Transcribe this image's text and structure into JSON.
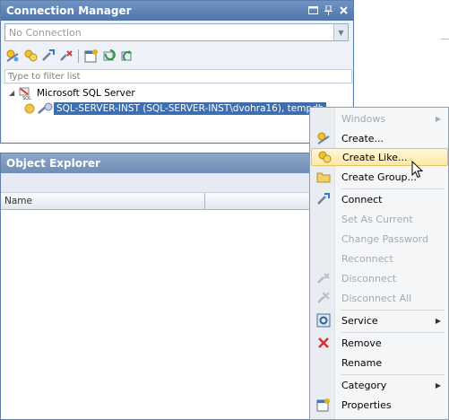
{
  "connection_manager": {
    "title": "Connection Manager",
    "title_buttons": [
      "window-position",
      "pin",
      "close"
    ],
    "connection_select": {
      "value": "No Connection"
    },
    "toolbar": [
      "create-connection-icon",
      "create-like-icon",
      "connect-icon",
      "disconnect-icon",
      "properties-icon",
      "refresh-icon",
      "refresh-green-icon"
    ],
    "filter_placeholder": "Type to filter list",
    "tree": {
      "root_label": "Microsoft SQL Server",
      "connection_label": "SQL-SERVER-INST (SQL-SERVER-INST\\dvohra16), tempdb"
    }
  },
  "object_explorer": {
    "title": "Object Explorer",
    "columns": [
      "Name",
      ""
    ]
  },
  "context_menu": {
    "items": [
      {
        "label": "Windows",
        "icon": "",
        "enabled": false,
        "submenu": true
      },
      {
        "label": "Create...",
        "icon": "create-connection-icon",
        "enabled": true,
        "submenu": false
      },
      {
        "label": "Create Like...",
        "icon": "create-like-icon",
        "enabled": true,
        "submenu": false,
        "highlighted": true
      },
      {
        "label": "Create Group...",
        "icon": "folder-icon",
        "enabled": true,
        "submenu": false
      },
      {
        "label": "Connect",
        "icon": "connect-icon",
        "enabled": true,
        "submenu": false
      },
      {
        "label": "Set As Current",
        "icon": "",
        "enabled": false,
        "submenu": false
      },
      {
        "label": "Change Password",
        "icon": "",
        "enabled": false,
        "submenu": false
      },
      {
        "label": "Reconnect",
        "icon": "",
        "enabled": false,
        "submenu": false
      },
      {
        "label": "Disconnect",
        "icon": "disconnect-icon",
        "enabled": false,
        "submenu": false
      },
      {
        "label": "Disconnect All",
        "icon": "disconnect-all-icon",
        "enabled": false,
        "submenu": false
      },
      {
        "label": "Service",
        "icon": "service-icon",
        "enabled": true,
        "submenu": true
      },
      {
        "label": "Remove",
        "icon": "remove-icon",
        "enabled": true,
        "submenu": false
      },
      {
        "label": "Rename",
        "icon": "",
        "enabled": true,
        "submenu": false
      },
      {
        "label": "Category",
        "icon": "",
        "enabled": true,
        "submenu": true
      },
      {
        "label": "Properties",
        "icon": "properties-icon",
        "enabled": true,
        "submenu": false
      }
    ]
  },
  "colors": {
    "title_bar": "#4f76ab",
    "selection": "#3d6fb0",
    "menu_hover": "#fde9a6"
  }
}
